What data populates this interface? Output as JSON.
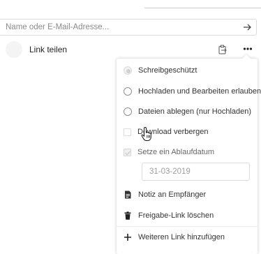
{
  "share": {
    "input_placeholder": "Name oder E-Mail-Adresse...",
    "submit_icon": "arrow-right-icon"
  },
  "link_row": {
    "label": "Link teilen",
    "copy_icon": "clipboard-icon",
    "more_icon": "more-dots-icon"
  },
  "popover": {
    "options": [
      {
        "label": "Schreibgeschützt",
        "type": "radio",
        "checked": true,
        "disabled": true
      },
      {
        "label": "Hochladen und Bearbeiten erlauben",
        "type": "radio",
        "checked": false
      },
      {
        "label": "Dateien ablegen (nur Hochladen)",
        "type": "radio",
        "checked": false
      },
      {
        "label": "Download verbergen",
        "type": "checkbox",
        "checked": false
      },
      {
        "label": "Setze ein Ablaufdatum",
        "type": "checkbox",
        "checked": true,
        "disabled": true
      }
    ],
    "expiration_date": "31-03-2019",
    "actions": [
      {
        "label": "Notiz an Empfänger",
        "icon": "note-icon"
      },
      {
        "label": "Freigabe-Link löschen",
        "icon": "trash-icon"
      },
      {
        "label": "Weiteren Link hinzufügen",
        "icon": "plus-icon"
      }
    ]
  },
  "colors": {
    "border": "#dbdbdb",
    "text": "#222222",
    "muted": "#8a8a8a"
  }
}
